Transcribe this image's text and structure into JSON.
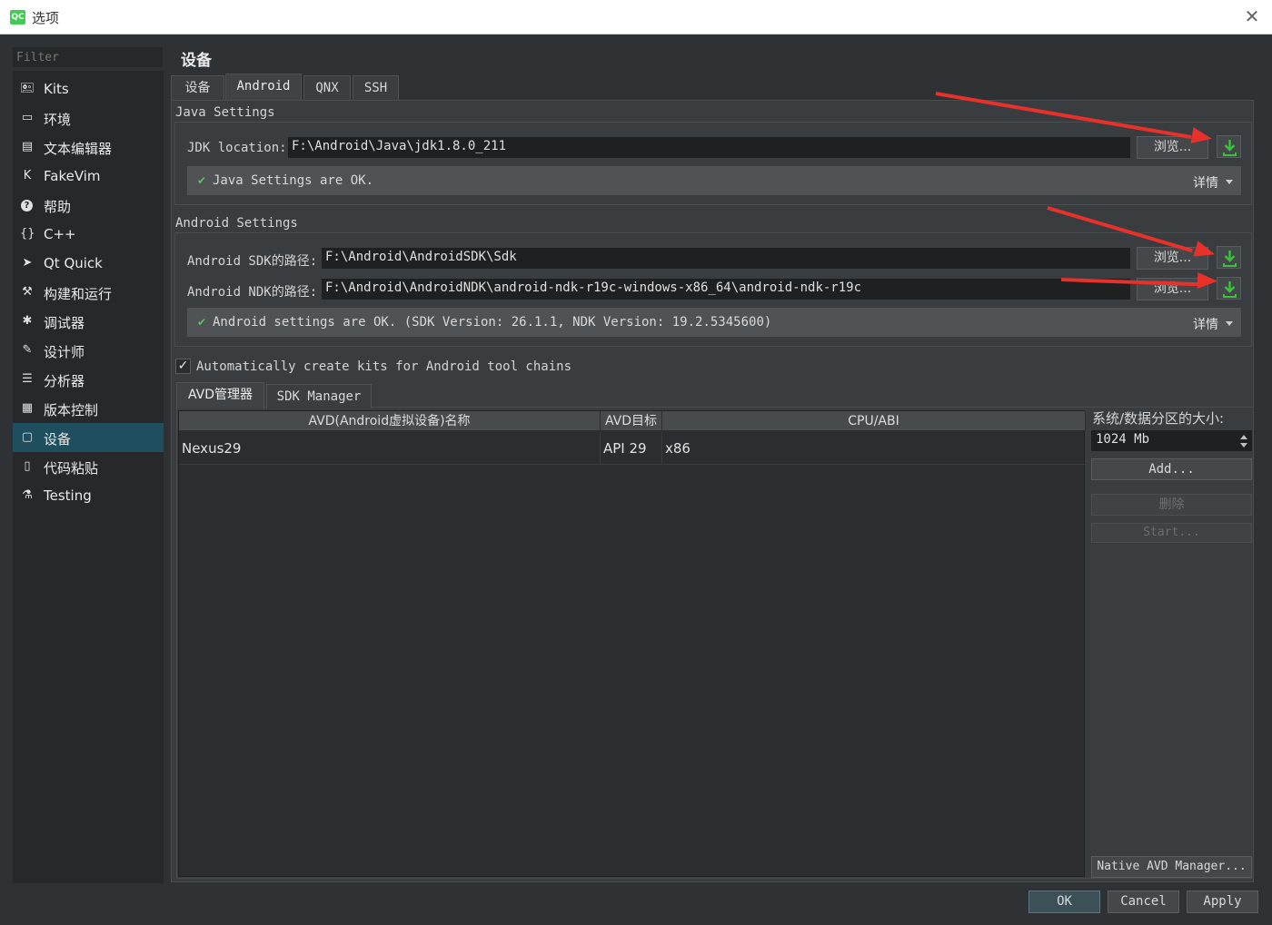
{
  "window": {
    "title": "选项",
    "app_icon_text": "QC"
  },
  "filter": {
    "placeholder": "Filter"
  },
  "sidebar": {
    "items": [
      {
        "label": "Kits",
        "icon": "kits-icon",
        "glyph": "🖭"
      },
      {
        "label": "环境",
        "icon": "monitor-icon",
        "glyph": "▭"
      },
      {
        "label": "文本编辑器",
        "icon": "text-editor-icon",
        "glyph": "▤"
      },
      {
        "label": "FakeVim",
        "icon": "fakevim-icon",
        "glyph": "K"
      },
      {
        "label": "帮助",
        "icon": "help-icon",
        "glyph": "?"
      },
      {
        "label": "C++",
        "icon": "braces-icon",
        "glyph": "{}"
      },
      {
        "label": "Qt Quick",
        "icon": "paper-plane-icon",
        "glyph": "➤"
      },
      {
        "label": "构建和运行",
        "icon": "hammer-icon",
        "glyph": "⚒"
      },
      {
        "label": "调试器",
        "icon": "bug-icon",
        "glyph": "✱"
      },
      {
        "label": "设计师",
        "icon": "pencil-icon",
        "glyph": "✎"
      },
      {
        "label": "分析器",
        "icon": "analyzer-icon",
        "glyph": "☰"
      },
      {
        "label": "版本控制",
        "icon": "version-control-icon",
        "glyph": "▦"
      },
      {
        "label": "设备",
        "icon": "device-icon",
        "glyph": "▢",
        "selected": true
      },
      {
        "label": "代码粘贴",
        "icon": "clipboard-icon",
        "glyph": "▯"
      },
      {
        "label": "Testing",
        "icon": "flask-icon",
        "glyph": "⚗"
      }
    ]
  },
  "page": {
    "title": "设备"
  },
  "tabs": [
    {
      "label": "设备"
    },
    {
      "label": "Android",
      "active": true
    },
    {
      "label": "QNX"
    },
    {
      "label": "SSH"
    }
  ],
  "java": {
    "group_title": "Java Settings",
    "jdk_label": "JDK location:",
    "jdk_value": "F:\\Android\\Java\\jdk1.8.0_211",
    "browse_label": "浏览...",
    "status": "Java Settings are OK.",
    "details_label": "详情"
  },
  "android": {
    "group_title": "Android Settings",
    "sdk_label": "Android SDK的路径:",
    "sdk_value": "F:\\Android\\AndroidSDK\\Sdk",
    "ndk_label": "Android NDK的路径:",
    "ndk_value": "F:\\Android\\AndroidNDK\\android-ndk-r19c-windows-x86_64\\android-ndk-r19c",
    "browse_label": "浏览...",
    "status": "Android settings are OK. (SDK Version: 26.1.1, NDK Version: 19.2.5345600)",
    "details_label": "详情"
  },
  "auto_create": {
    "label": "Automatically create kits for Android tool chains",
    "checked": true,
    "mark": "✓"
  },
  "avd": {
    "tabs": [
      {
        "label": "AVD管理器",
        "active": true
      },
      {
        "label": "SDK Manager"
      }
    ],
    "columns": [
      "AVD(Android虚拟设备)名称",
      "AVD目标",
      "CPU/ABI"
    ],
    "rows": [
      {
        "name": "Nexus29",
        "target": "API 29",
        "abi": "x86"
      }
    ],
    "partition_label": "系统/数据分区的大小:",
    "partition_value": "1024 Mb",
    "add_label": "Add...",
    "delete_label": "删除",
    "start_label": "Start...",
    "native_label": "Native AVD Manager..."
  },
  "footer": {
    "ok_label": "OK",
    "cancel_label": "Cancel",
    "apply_label": "Apply"
  },
  "colors": {
    "annotation_arrow": "#e8312b",
    "download_icon": "#3fbf3f",
    "selected_nav": "#1f4f5e"
  }
}
